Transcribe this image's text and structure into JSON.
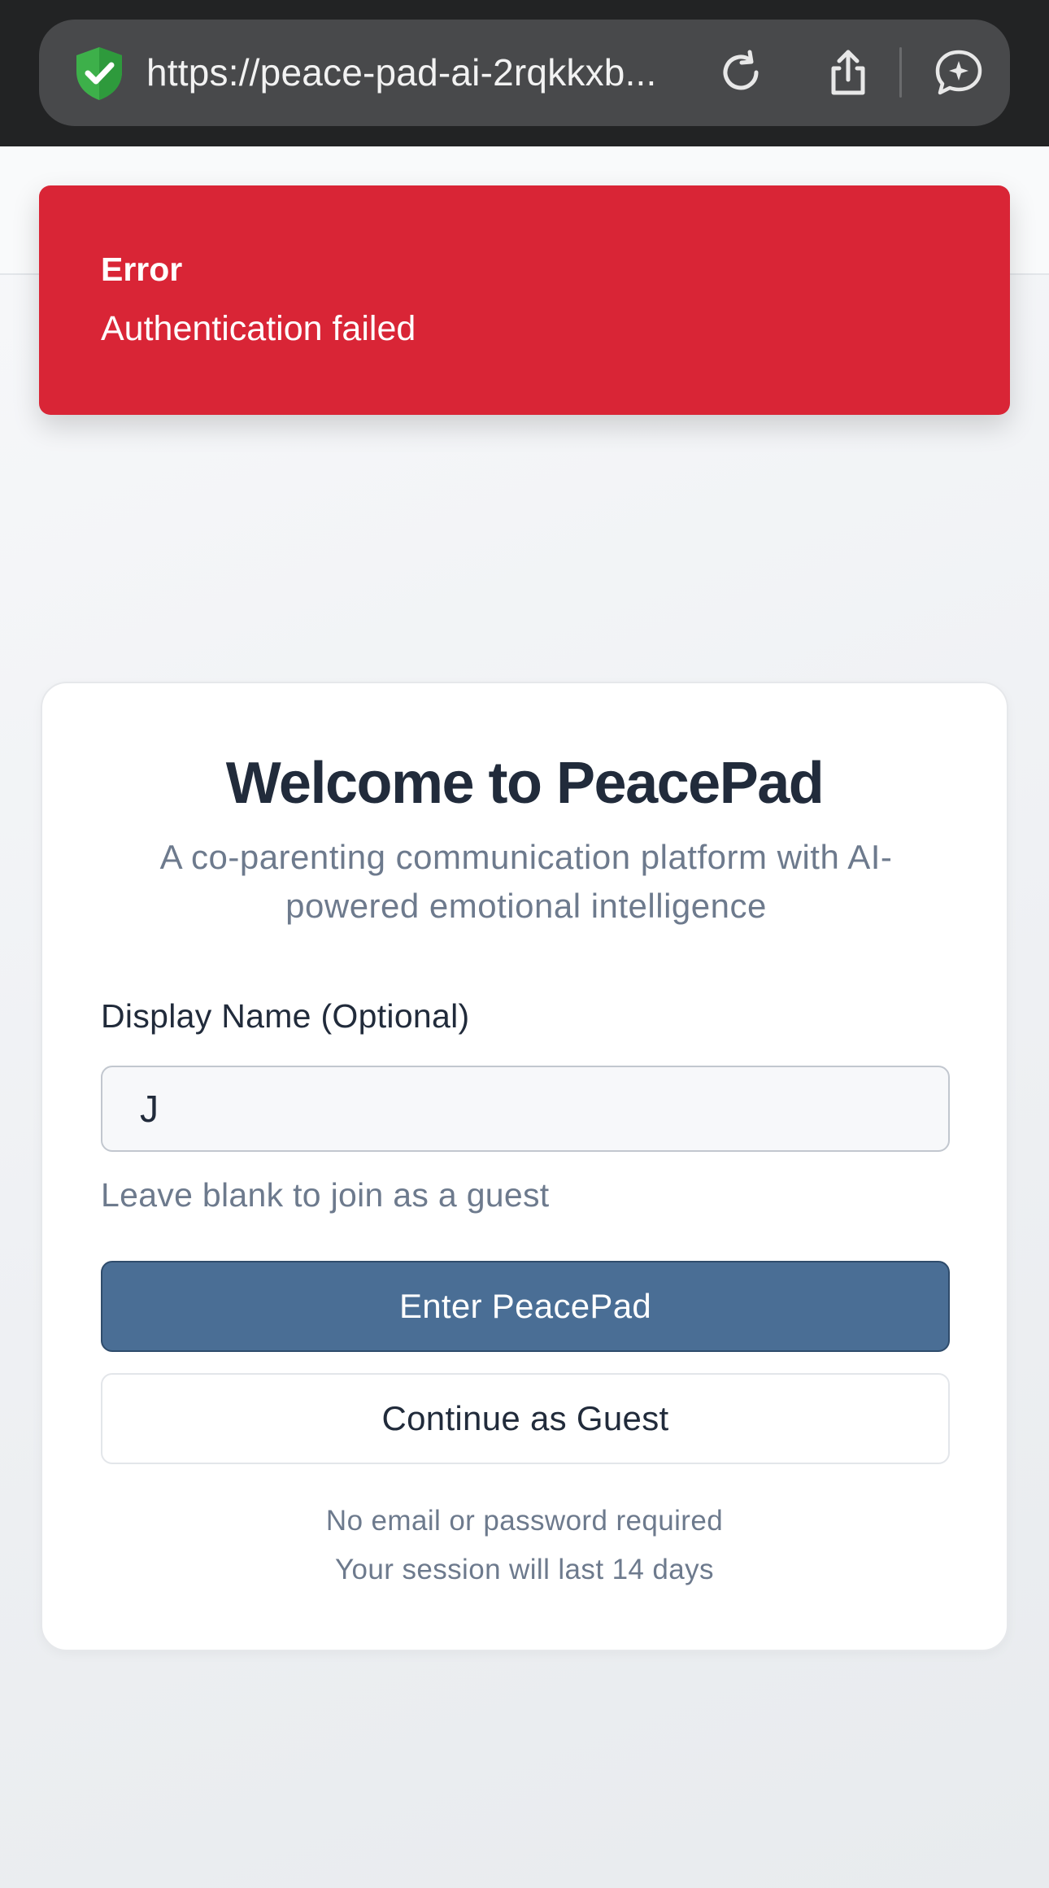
{
  "browser": {
    "url": "https://peace-pad-ai-2rqkkxb..."
  },
  "toast": {
    "title": "Error",
    "message": "Authentication failed",
    "color": "#d92536"
  },
  "card": {
    "title": "Welcome to PeacePad",
    "subtitle": "A co-parenting communication platform with AI-powered emotional intelligence",
    "display_name_label": "Display Name (Optional)",
    "display_name_value": "J",
    "display_name_hint": "Leave blank to join as a guest",
    "enter_button_label": "Enter PeacePad",
    "guest_button_label": "Continue as Guest",
    "footnote_1": "No email or password required",
    "footnote_2": "Your session will last 14 days"
  },
  "colors": {
    "primary": "#4a6e95",
    "error": "#d92536",
    "text_dark": "#212b3b",
    "text_muted": "#6d7a8d"
  }
}
